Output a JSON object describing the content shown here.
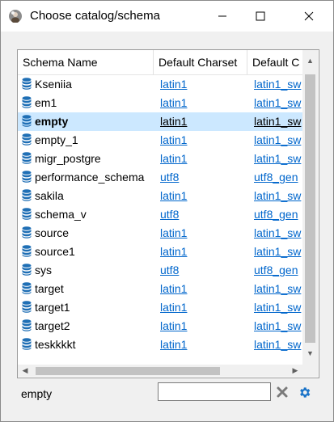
{
  "window": {
    "title": "Choose catalog/schema",
    "app_icon": "app-avatar-icon",
    "controls": [
      "minimize-icon",
      "maximize-icon",
      "close-icon"
    ]
  },
  "table": {
    "columns": [
      "Schema Name",
      "Default Charset",
      "Default C"
    ],
    "rows": [
      {
        "name": "Kseniia",
        "charset": "latin1",
        "collation": "latin1_sw"
      },
      {
        "name": "em1",
        "charset": "latin1",
        "collation": "latin1_sw"
      },
      {
        "name": "empty",
        "charset": "latin1",
        "collation": "latin1_sw",
        "selected": true
      },
      {
        "name": "empty_1",
        "charset": "latin1",
        "collation": "latin1_sw"
      },
      {
        "name": "migr_postgre",
        "charset": "latin1",
        "collation": "latin1_sw"
      },
      {
        "name": "performance_schema",
        "charset": "utf8",
        "collation": "utf8_gen"
      },
      {
        "name": "sakila",
        "charset": "latin1",
        "collation": "latin1_sw"
      },
      {
        "name": "schema_v",
        "charset": "utf8",
        "collation": "utf8_gen"
      },
      {
        "name": "source",
        "charset": "latin1",
        "collation": "latin1_sw"
      },
      {
        "name": "source1",
        "charset": "latin1",
        "collation": "latin1_sw"
      },
      {
        "name": "sys",
        "charset": "utf8",
        "collation": "utf8_gen"
      },
      {
        "name": "target",
        "charset": "latin1",
        "collation": "latin1_sw"
      },
      {
        "name": "target1",
        "charset": "latin1",
        "collation": "latin1_sw"
      },
      {
        "name": "target2",
        "charset": "latin1",
        "collation": "latin1_sw"
      },
      {
        "name": "teskkkkt",
        "charset": "latin1",
        "collation": "latin1_sw"
      }
    ],
    "row_icon": "database-icon"
  },
  "footer": {
    "selected_label": "empty",
    "filter_value": "",
    "filter_placeholder": "",
    "clear_icon": "clear-x-icon",
    "settings_icon": "gear-icon"
  },
  "colors": {
    "link": "#0066cc",
    "selection": "#cce8ff",
    "db_icon": "#1f6fb5",
    "gear": "#1a73c8",
    "clear": "#7a7a7a"
  }
}
